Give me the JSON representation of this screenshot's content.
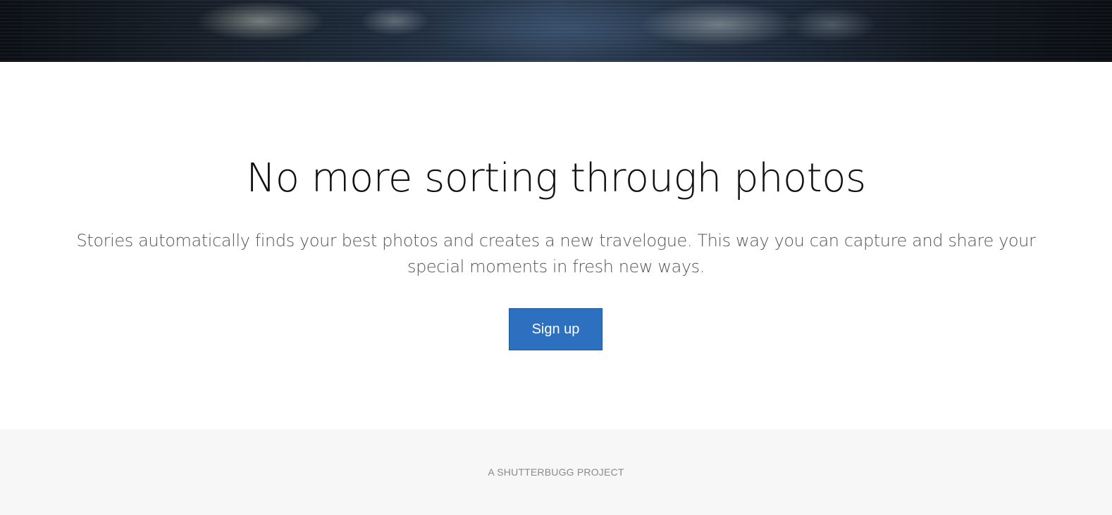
{
  "hero": {
    "image_label": "water-reflection-photo"
  },
  "main": {
    "headline": "No more sorting through photos",
    "description": "Stories automatically finds your best photos and creates a new travelogue. This way you can capture and share your special moments in fresh new ways.",
    "signup_label": "Sign up"
  },
  "footer": {
    "text": "A SHUTTERBUGG PROJECT"
  },
  "colors": {
    "accent": "#2d70bf",
    "footer_bg": "#f7f7f7",
    "headline": "#111111",
    "body_text": "#555555"
  }
}
